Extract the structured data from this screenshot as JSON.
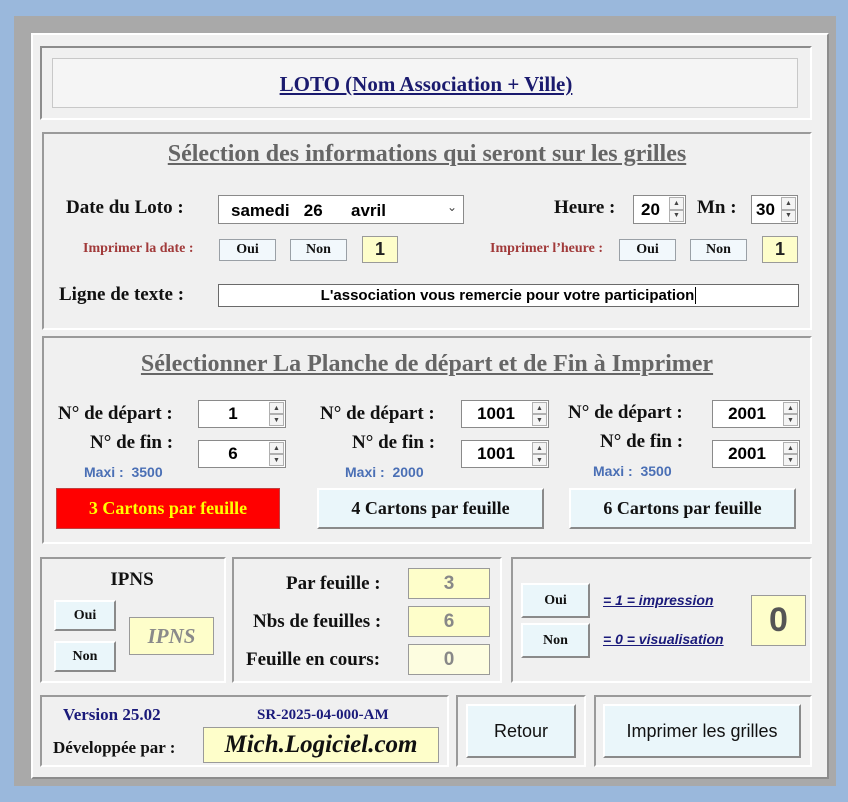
{
  "title": "LOTO (Nom Association + Ville)",
  "info_section": {
    "heading": "Sélection des informations qui seront sur les grilles",
    "date_label": "Date du Loto :",
    "date_value": "samedi   26      avril",
    "heure_label": "Heure :",
    "heure_value": "20",
    "mn_label": "Mn :",
    "mn_value": "30",
    "print_date_label": "Imprimer la date :",
    "print_date_oui": "Oui",
    "print_date_non": "Non",
    "print_date_flag": "1",
    "print_heure_label": "Imprimer l’heure :",
    "print_heure_oui": "Oui",
    "print_heure_non": "Non",
    "print_heure_flag": "1",
    "text_line_label": "Ligne de texte :",
    "text_line_value": "L'association vous remercie pour votre participation"
  },
  "planche_section": {
    "heading": "Sélectionner La Planche de départ et de Fin à Imprimer",
    "columns": [
      {
        "depart_label": "N° de départ :",
        "depart_value": "1",
        "fin_label": "N° de fin :",
        "fin_value": "6",
        "maxi": "Maxi :  3500",
        "button": "3 Cartons par feuille"
      },
      {
        "depart_label": "N° de départ :",
        "depart_value": "1001",
        "fin_label": "N° de fin :",
        "fin_value": "1001",
        "maxi": "Maxi :  2000",
        "button": "4 Cartons par feuille"
      },
      {
        "depart_label": "N° de départ :",
        "depart_value": "2001",
        "fin_label": "N° de fin :",
        "fin_value": "2001",
        "maxi": "Maxi :  3500",
        "button": "6 Cartons par feuille"
      }
    ],
    "active_color": "#ff0000",
    "active_text_color": "#ffff00"
  },
  "ipns": {
    "title": "IPNS",
    "oui": "Oui",
    "non": "Non",
    "badge": "IPNS"
  },
  "stats": {
    "par_feuille_label": "Par feuille :",
    "par_feuille_value": "3",
    "nbs_feuilles_label": "Nbs de feuilles :",
    "nbs_feuilles_value": "6",
    "feuille_en_cours_label": "Feuille en cours:",
    "feuille_en_cours_value": "0"
  },
  "mode": {
    "oui": "Oui",
    "non": "Non",
    "impression_text": "= 1 = impression",
    "visualisation_text": "= 0 = visualisation",
    "value": "0"
  },
  "footer": {
    "version": "Version 25.02",
    "ref": "SR-2025-04-000-AM",
    "dev_label": "Développée par :",
    "dev_name": "Mich.Logiciel.com",
    "retour": "Retour",
    "imprimer": "Imprimer les grilles"
  }
}
